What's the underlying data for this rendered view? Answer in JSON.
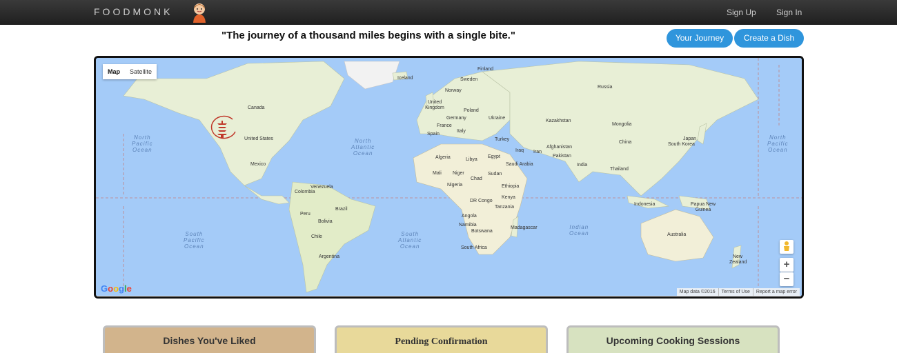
{
  "navbar": {
    "brand": "FOODMONK",
    "logo_icon": "monk-icon",
    "sign_up": "Sign Up",
    "sign_in": "Sign In"
  },
  "hero": {
    "quote": "\"The journey of a thousand miles begins with a single bite.\"",
    "your_journey": "Your Journey",
    "create_dish": "Create a Dish"
  },
  "map": {
    "type_map": "Map",
    "type_satellite": "Satellite",
    "marker_icon": "pagoda-marker-icon",
    "countries": [
      "Iceland",
      "Finland",
      "Sweden",
      "Norway",
      "Russia",
      "United Kingdom",
      "Poland",
      "Germany",
      "Ukraine",
      "France",
      "Italy",
      "Spain",
      "Kazakhstan",
      "Mongolia",
      "Turkey",
      "Afghanistan",
      "Iraq",
      "Iran",
      "China",
      "South Korea",
      "Japan",
      "Algeria",
      "Libya",
      "Egypt",
      "Saudi Arabia",
      "Pakistan",
      "India",
      "Thailand",
      "Mali",
      "Niger",
      "Chad",
      "Sudan",
      "Nigeria",
      "Ethiopia",
      "DR Congo",
      "Kenya",
      "Tanzania",
      "Angola",
      "Namibia",
      "Botswana",
      "Madagascar",
      "South Africa",
      "Canada",
      "United States",
      "Mexico",
      "Venezuela",
      "Colombia",
      "Brazil",
      "Peru",
      "Bolivia",
      "Chile",
      "Argentina",
      "Indonesia",
      "Papua New Guinea",
      "Australia",
      "New Zealand"
    ],
    "oceans": {
      "north_pacific": [
        "North",
        "Pacific",
        "Ocean"
      ],
      "north_atlantic": [
        "North",
        "Atlantic",
        "Ocean"
      ],
      "south_pacific": [
        "South",
        "Pacific",
        "Ocean"
      ],
      "south_atlantic": [
        "South",
        "Atlantic",
        "Ocean"
      ],
      "indian": [
        "Indian",
        "Ocean"
      ]
    },
    "zoom_in": "+",
    "zoom_out": "−",
    "pegman_icon": "pegman-icon",
    "google_logo": "Google",
    "map_data": "Map data ©2016",
    "terms": "Terms of Use",
    "report": "Report a map error"
  },
  "panels": [
    {
      "title": "Dishes You've Liked",
      "color": "#d2b48c"
    },
    {
      "title": "Pending Confirmation",
      "color": "#e8d99a"
    },
    {
      "title": "Upcoming Cooking Sessions",
      "color": "#d7e2c0"
    }
  ],
  "colors": {
    "accent": "#2f95dc",
    "navbar": "#2a2a2a",
    "ocean": "#a4cbf8",
    "land": "#e8efd6"
  }
}
